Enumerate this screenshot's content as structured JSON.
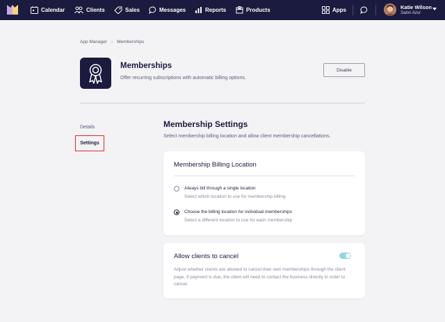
{
  "nav": {
    "items": [
      {
        "label": "Calendar",
        "icon": "calendar-icon"
      },
      {
        "label": "Clients",
        "icon": "clients-icon"
      },
      {
        "label": "Sales",
        "icon": "tag-icon"
      },
      {
        "label": "Messages",
        "icon": "chat-icon"
      },
      {
        "label": "Reports",
        "icon": "bar-chart-icon"
      },
      {
        "label": "Products",
        "icon": "box-icon"
      }
    ],
    "apps_label": "Apps",
    "user": {
      "name": "Katie Wilson",
      "business": "Salon Azul"
    }
  },
  "breadcrumb": {
    "parent": "App Manager",
    "current": "Memberships"
  },
  "app": {
    "title": "Memberships",
    "subtitle": "Offer recurring subscriptions with automatic billing options.",
    "disable_label": "Disable"
  },
  "sidebar": {
    "details": "Details",
    "settings": "Settings"
  },
  "section": {
    "title": "Membership Settings",
    "subtitle": "Select membership billing location and allow client membership cancellations."
  },
  "billing": {
    "title": "Membership Billing Location",
    "options": [
      {
        "label": "Always bill through a single location",
        "sub": "Select which location to use for membership billing",
        "selected": false
      },
      {
        "label": "Choose the billing location for individual memberships",
        "sub": "Select a different location to use for each membership",
        "selected": true
      }
    ]
  },
  "cancel": {
    "title": "Allow clients to cancel",
    "enabled": true,
    "description": "Adjust whether clients are allowed to cancel their own memberships through the client page. If payment is due, the client will need to contact the business directly in order to cancel."
  },
  "colors": {
    "nav_bg": "#1b1b3f",
    "accent_toggle": "#8fd6e0",
    "highlight": "#e0242b"
  }
}
